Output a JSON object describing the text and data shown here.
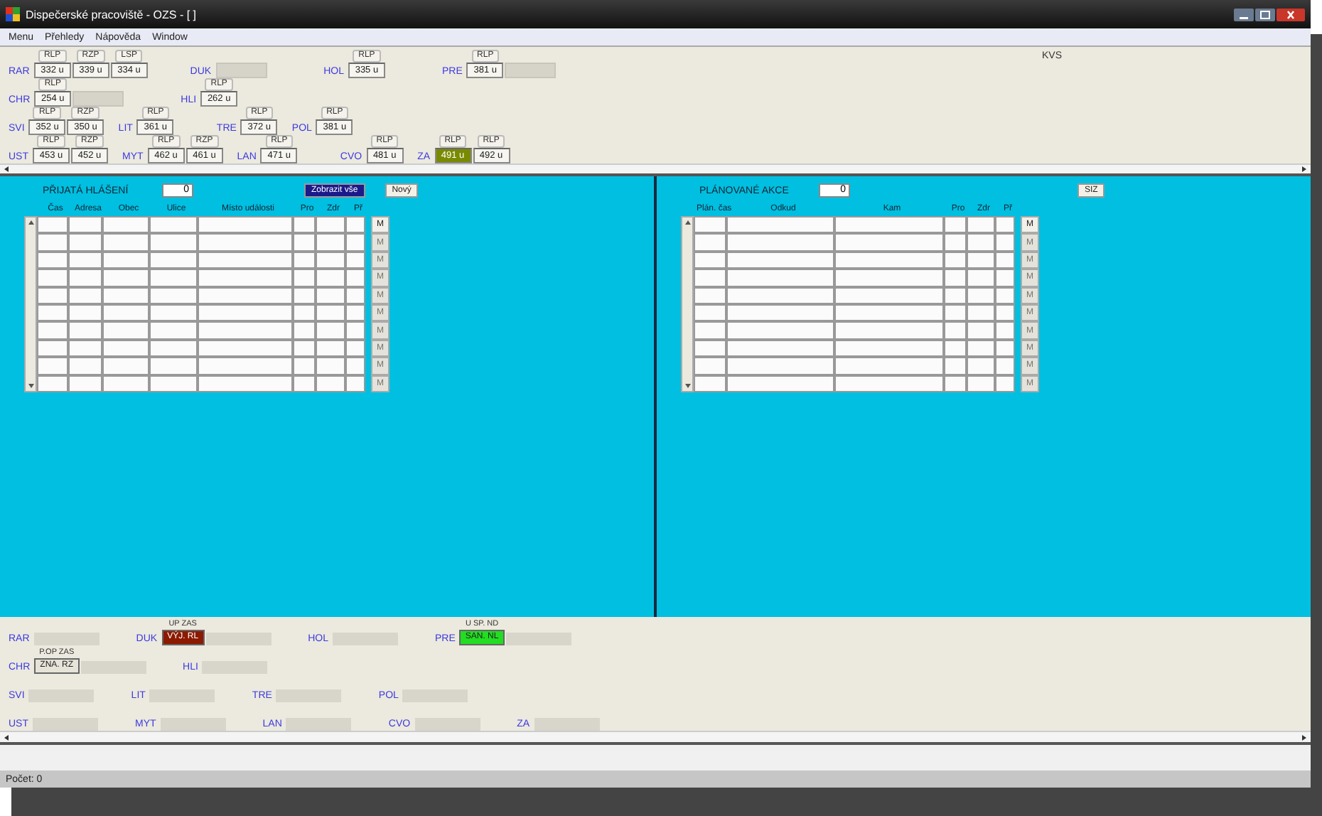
{
  "window": {
    "title": "Dispečerské pracoviště - OZS - [ ]"
  },
  "menu": [
    "Menu",
    "Přehledy",
    "Nápověda",
    "Window"
  ],
  "top_panel": {
    "corner_label": "KVS",
    "lines": [
      {
        "groups": [
          {
            "station": "RAR",
            "units": [
              {
                "type": "RLP",
                "value": "332 u",
                "highlight": false
              },
              {
                "type": "RZP",
                "value": "339 u",
                "highlight": false
              },
              {
                "type": "LSP",
                "value": "334 u",
                "highlight": false
              }
            ]
          },
          {
            "station": "DUK",
            "spare": true
          },
          {
            "station": "HOL",
            "units": [
              {
                "type": "RLP",
                "value": "335 u",
                "highlight": false
              }
            ]
          },
          {
            "station": "PRE",
            "units": [
              {
                "type": "RLP",
                "value": "381 u",
                "highlight": false
              }
            ],
            "spare": true
          }
        ]
      },
      {
        "groups": [
          {
            "station": "CHR",
            "units": [
              {
                "type": "RLP",
                "value": "254 u",
                "highlight": false
              }
            ],
            "spare": true
          },
          {
            "station": "HLI",
            "units": [
              {
                "type": "RLP",
                "value": "262 u",
                "highlight": false
              }
            ]
          }
        ]
      },
      {
        "groups": [
          {
            "station": "SVI",
            "units": [
              {
                "type": "RLP",
                "value": "352 u",
                "highlight": false
              },
              {
                "type": "RZP",
                "value": "350 u",
                "highlight": false
              }
            ]
          },
          {
            "station": "LIT",
            "units": [
              {
                "type": "RLP",
                "value": "361 u",
                "highlight": false
              }
            ]
          },
          {
            "station": "TRE",
            "units": [
              {
                "type": "RLP",
                "value": "372 u",
                "highlight": false
              }
            ]
          },
          {
            "station": "POL",
            "units": [
              {
                "type": "RLP",
                "value": "381 u",
                "highlight": false
              }
            ]
          }
        ]
      },
      {
        "groups": [
          {
            "station": "UST",
            "units": [
              {
                "type": "RLP",
                "value": "453 u",
                "highlight": false
              },
              {
                "type": "RZP",
                "value": "452 u",
                "highlight": false
              }
            ]
          },
          {
            "station": "MYT",
            "units": [
              {
                "type": "RLP",
                "value": "462 u",
                "highlight": false
              },
              {
                "type": "RZP",
                "value": "461 u",
                "highlight": false
              }
            ]
          },
          {
            "station": "LAN",
            "units": [
              {
                "type": "RLP",
                "value": "471 u",
                "highlight": false
              }
            ]
          },
          {
            "station": "CVO",
            "units": [
              {
                "type": "RLP",
                "value": "481 u",
                "highlight": false
              }
            ]
          },
          {
            "station": "ZA",
            "units": [
              {
                "type": "RLP",
                "value": "491 u",
                "highlight": true
              },
              {
                "type": "RLP",
                "value": "492 u",
                "highlight": false
              }
            ]
          }
        ]
      }
    ]
  },
  "panels": [
    {
      "title": "PŘIJATÁ HLÁŠENÍ",
      "counter": "0",
      "buttons": [
        {
          "label": "Zobrazit vše",
          "kind": "dark"
        },
        {
          "label": "Nový",
          "kind": "light"
        }
      ],
      "columns": [
        "Čas",
        "Adresa",
        "Obec",
        "Ulice",
        "Místo události",
        "Pro",
        "Zdr",
        "Př"
      ],
      "rows": [
        {
          "button": "M",
          "disabled": false
        },
        {
          "button": "M",
          "disabled": true
        },
        {
          "button": "M",
          "disabled": true
        },
        {
          "button": "M",
          "disabled": true
        },
        {
          "button": "M",
          "disabled": true
        },
        {
          "button": "M",
          "disabled": true
        },
        {
          "button": "M",
          "disabled": true
        },
        {
          "button": "M",
          "disabled": true
        },
        {
          "button": "M",
          "disabled": true
        },
        {
          "button": "M",
          "disabled": true
        }
      ]
    },
    {
      "title": "PLÁNOVANÉ AKCE",
      "counter": "0",
      "buttons": [
        {
          "label": "SIZ",
          "kind": "light"
        }
      ],
      "columns": [
        "Plán. čas",
        "Odkud",
        "Kam",
        "Pro",
        "Zdr",
        "Př"
      ],
      "rows": [
        {
          "button": "M",
          "disabled": false
        },
        {
          "button": "M",
          "disabled": true
        },
        {
          "button": "M",
          "disabled": true
        },
        {
          "button": "M",
          "disabled": true
        },
        {
          "button": "M",
          "disabled": true
        },
        {
          "button": "M",
          "disabled": true
        },
        {
          "button": "M",
          "disabled": true
        },
        {
          "button": "M",
          "disabled": true
        },
        {
          "button": "M",
          "disabled": true
        },
        {
          "button": "M",
          "disabled": true
        }
      ]
    }
  ],
  "bottom_panel": {
    "lines": [
      {
        "groups": [
          {
            "station": "RAR"
          },
          {
            "station": "DUK",
            "status": {
              "header": "UP ZAS",
              "value": "VÝJ. RL",
              "color": "#8b1a00"
            }
          },
          {
            "station": "HOL"
          },
          {
            "station": "PRE",
            "status": {
              "header": "U SP. ND",
              "value": "SAN. NL",
              "color": "#22dd22"
            }
          }
        ]
      },
      {
        "groups": [
          {
            "station": "CHR",
            "status": {
              "header": "P.OP ZAS",
              "value": "ZNA. RZ",
              "color": "#e6e3d8"
            }
          },
          {
            "station": "HLI"
          }
        ]
      },
      {
        "groups": [
          {
            "station": "SVI"
          },
          {
            "station": "LIT"
          },
          {
            "station": "TRE"
          },
          {
            "station": "POL"
          }
        ]
      },
      {
        "groups": [
          {
            "station": "UST"
          },
          {
            "station": "MYT"
          },
          {
            "station": "LAN"
          },
          {
            "station": "CVO"
          },
          {
            "station": "ZA"
          }
        ]
      }
    ]
  },
  "status_bar": "Počet: 0"
}
